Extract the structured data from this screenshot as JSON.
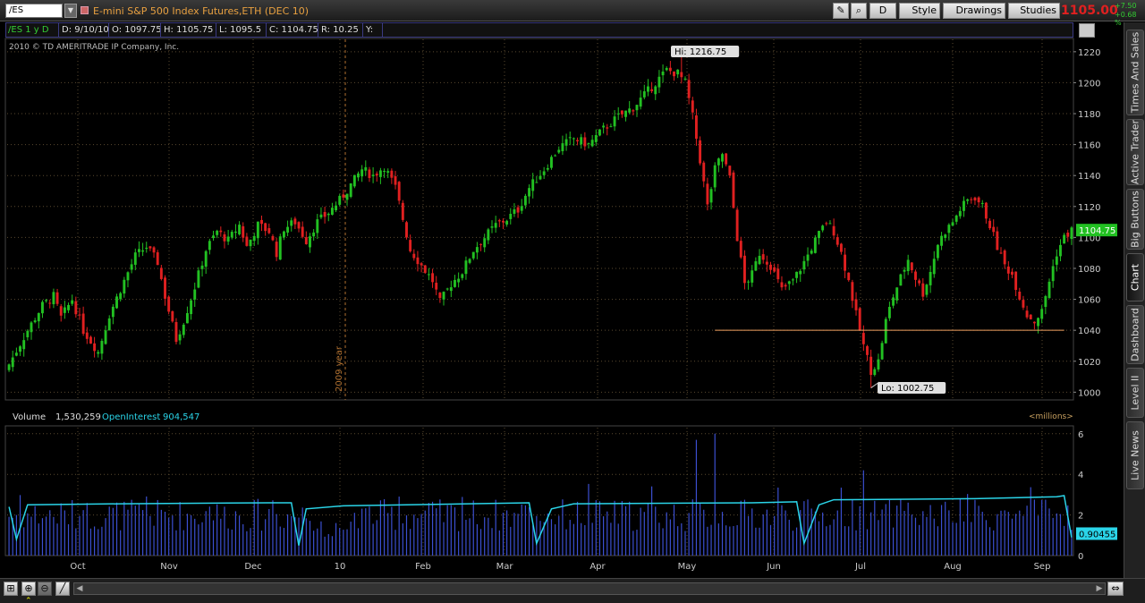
{
  "toolbar": {
    "symbol": "/ES",
    "description": "E-mini S&P 500 Index Futures,ETH (DEC 10)",
    "aggregation_label": "D",
    "style_label": "Style",
    "drawings_label": "Drawings",
    "studies_label": "Studies",
    "last_price": "1105.00",
    "net_change": "+7.50",
    "pct_change": "+0.68 %"
  },
  "chart_header": {
    "symbol_period": "/ES 1 y D",
    "date": "D: 9/10/10",
    "open": "O: 1097.75",
    "high": "H: 1105.75",
    "low": "L: 1095.5",
    "close": "C: 1104.75",
    "range": "R: 10.25",
    "y": "Y:"
  },
  "copyright": "2010 © TD AMERITRADE IP Company, Inc.",
  "volume_header": {
    "volume_label": "Volume",
    "volume_value": "1,530,259",
    "oi_label": "OpenInterest",
    "oi_value": "904,547",
    "units": "<millions>"
  },
  "sidebar": {
    "tabs": [
      "Times And Sales",
      "Active Trader",
      "Big Buttons",
      "Chart",
      "Dashboard",
      "Level II",
      "Live News"
    ],
    "active": "Chart"
  },
  "colors": {
    "up": "#22c022",
    "down": "#e02020",
    "background": "#000000",
    "grid": "#5a4a30",
    "volume": "#3b4fd0",
    "open_interest": "#2ad4e8",
    "support_line": "#f0a060",
    "last_price_label": "#22c022",
    "oi_label": "#2ad4e8"
  },
  "chart_data": [
    {
      "type": "candlestick",
      "symbol": "/ES",
      "aggregation": "1 year, daily",
      "y_ticks": [
        1000,
        1020,
        1040,
        1060,
        1080,
        1100,
        1120,
        1140,
        1160,
        1180,
        1200,
        1220
      ],
      "ylim": [
        995,
        1228
      ],
      "x_tick_labels": [
        "Oct",
        "Nov",
        "Dec",
        "10",
        "Feb",
        "Mar",
        "Apr",
        "May",
        "Jun",
        "Jul",
        "Aug",
        "Sep"
      ],
      "year_marker": "2009 year",
      "high_annotation": "Hi: 1216.75",
      "low_annotation": "Lo: 1002.75",
      "last_value_label": "1104.75",
      "support_line": 1040,
      "close_path": [
        [
          0,
          1018
        ],
        [
          5,
          1040
        ],
        [
          9,
          1056
        ],
        [
          12,
          1062
        ],
        [
          14,
          1048
        ],
        [
          17,
          1060
        ],
        [
          20,
          1040
        ],
        [
          24,
          1026
        ],
        [
          27,
          1050
        ],
        [
          31,
          1072
        ],
        [
          34,
          1088
        ],
        [
          37,
          1094
        ],
        [
          40,
          1084
        ],
        [
          42,
          1062
        ],
        [
          45,
          1034
        ],
        [
          47,
          1046
        ],
        [
          50,
          1068
        ],
        [
          53,
          1092
        ],
        [
          56,
          1104
        ],
        [
          59,
          1098
        ],
        [
          62,
          1108
        ],
        [
          64,
          1094
        ],
        [
          67,
          1108
        ],
        [
          70,
          1104
        ],
        [
          72,
          1090
        ],
        [
          74,
          1106
        ],
        [
          77,
          1110
        ],
        [
          80,
          1098
        ],
        [
          83,
          1110
        ],
        [
          86,
          1116
        ],
        [
          89,
          1124
        ],
        [
          92,
          1134
        ],
        [
          95,
          1144
        ],
        [
          98,
          1140
        ],
        [
          101,
          1146
        ],
        [
          104,
          1132
        ],
        [
          106,
          1112
        ],
        [
          108,
          1092
        ],
        [
          111,
          1082
        ],
        [
          114,
          1072
        ],
        [
          116,
          1058
        ],
        [
          119,
          1070
        ],
        [
          122,
          1078
        ],
        [
          125,
          1092
        ],
        [
          128,
          1100
        ],
        [
          131,
          1108
        ],
        [
          134,
          1112
        ],
        [
          137,
          1118
        ],
        [
          140,
          1132
        ],
        [
          144,
          1144
        ],
        [
          148,
          1158
        ],
        [
          152,
          1164
        ],
        [
          156,
          1160
        ],
        [
          160,
          1170
        ],
        [
          164,
          1178
        ],
        [
          168,
          1184
        ],
        [
          171,
          1192
        ],
        [
          174,
          1200
        ],
        [
          177,
          1208
        ],
        [
          180,
          1206
        ],
        [
          182,
          1200
        ],
        [
          184,
          1178
        ],
        [
          186,
          1150
        ],
        [
          188,
          1120
        ],
        [
          190,
          1144
        ],
        [
          192,
          1154
        ],
        [
          194,
          1138
        ],
        [
          196,
          1100
        ],
        [
          198,
          1070
        ],
        [
          200,
          1076
        ],
        [
          202,
          1090
        ],
        [
          205,
          1082
        ],
        [
          208,
          1066
        ],
        [
          211,
          1072
        ],
        [
          214,
          1084
        ],
        [
          217,
          1098
        ],
        [
          220,
          1110
        ],
        [
          222,
          1104
        ],
        [
          224,
          1090
        ],
        [
          226,
          1072
        ],
        [
          228,
          1050
        ],
        [
          230,
          1030
        ],
        [
          232,
          1014
        ],
        [
          234,
          1020
        ],
        [
          236,
          1046
        ],
        [
          238,
          1062
        ],
        [
          240,
          1074
        ],
        [
          242,
          1086
        ],
        [
          244,
          1074
        ],
        [
          246,
          1064
        ],
        [
          248,
          1078
        ],
        [
          250,
          1096
        ],
        [
          252,
          1104
        ],
        [
          254,
          1110
        ],
        [
          256,
          1118
        ],
        [
          258,
          1124
        ],
        [
          260,
          1126
        ],
        [
          262,
          1120
        ],
        [
          264,
          1108
        ],
        [
          266,
          1094
        ],
        [
          268,
          1082
        ],
        [
          270,
          1076
        ],
        [
          272,
          1062
        ],
        [
          274,
          1050
        ],
        [
          276,
          1046
        ],
        [
          278,
          1052
        ],
        [
          280,
          1072
        ],
        [
          282,
          1090
        ],
        [
          284,
          1100
        ],
        [
          286,
          1104.75
        ]
      ],
      "volume_ticks": [
        0,
        2,
        4,
        6
      ],
      "volume_label_value": "0.90455",
      "open_interest_path": [
        [
          0,
          2.4
        ],
        [
          2,
          0.8
        ],
        [
          5,
          2.5
        ],
        [
          30,
          2.55
        ],
        [
          70,
          2.6
        ],
        [
          76,
          2.6
        ],
        [
          78,
          0.5
        ],
        [
          80,
          2.3
        ],
        [
          90,
          2.45
        ],
        [
          140,
          2.6
        ],
        [
          142,
          0.6
        ],
        [
          146,
          2.3
        ],
        [
          152,
          2.55
        ],
        [
          200,
          2.6
        ],
        [
          212,
          2.65
        ],
        [
          214,
          0.6
        ],
        [
          218,
          2.5
        ],
        [
          222,
          2.75
        ],
        [
          260,
          2.8
        ],
        [
          282,
          2.9
        ],
        [
          284,
          2.95
        ],
        [
          286,
          0.9
        ]
      ]
    }
  ]
}
